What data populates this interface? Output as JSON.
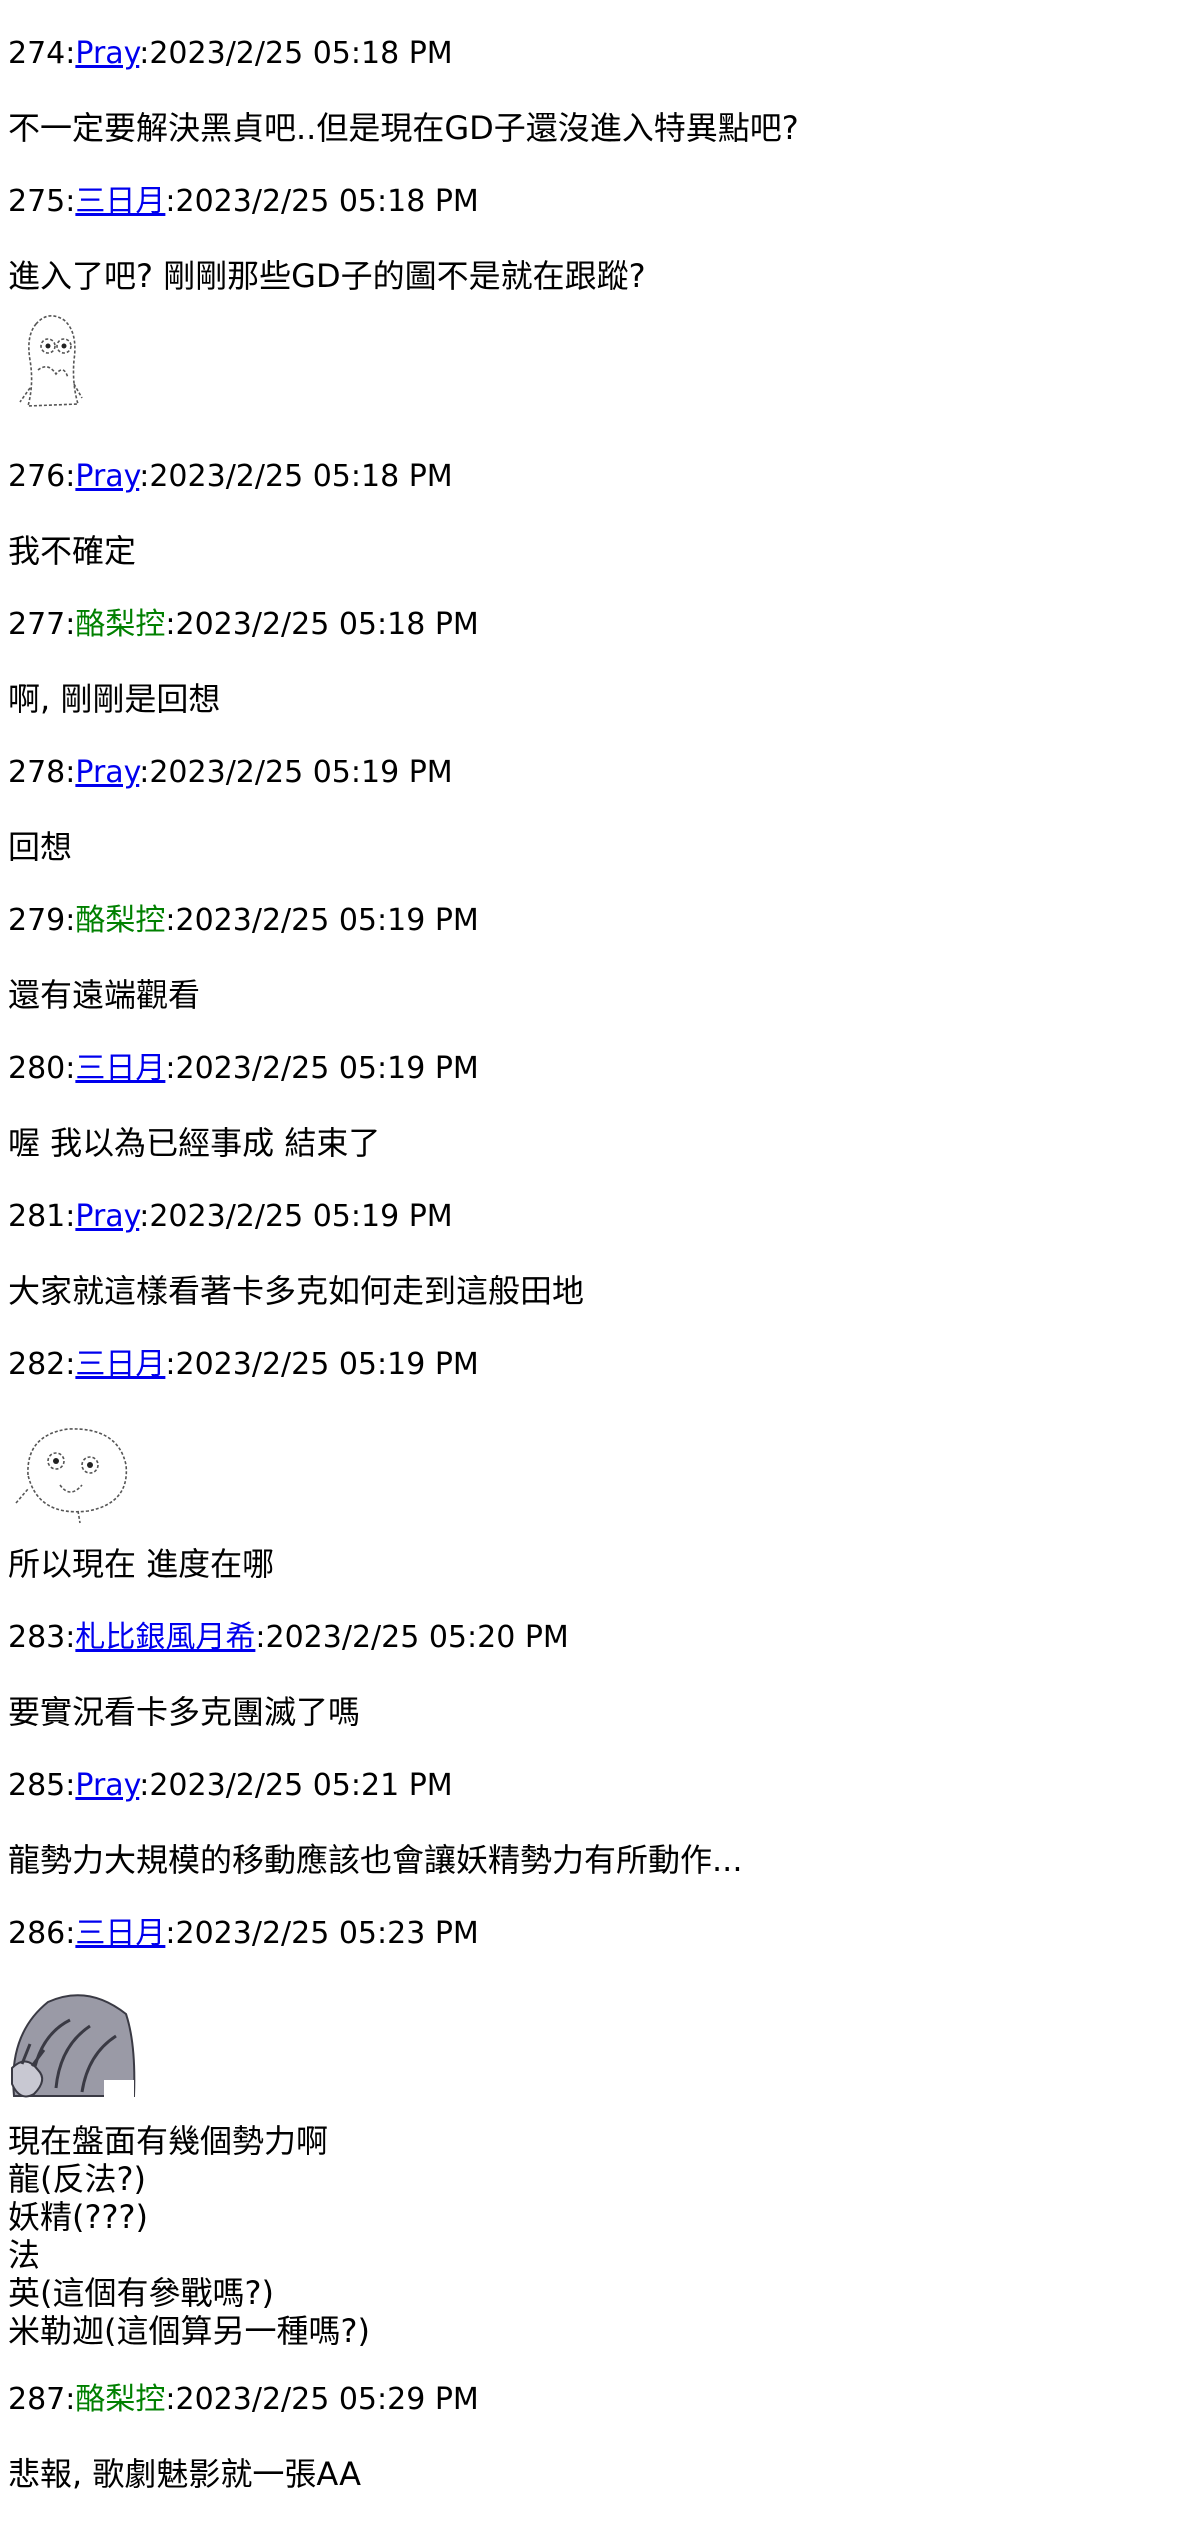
{
  "posts": [
    {
      "num": "274",
      "author": "Pray",
      "author_linked": true,
      "time": "2023/2/25 05:18 PM",
      "lines": [
        "不一定要解決黑貞吧..但是現在GD子還沒進入特異點吧?"
      ]
    },
    {
      "num": "275",
      "author": "三日月",
      "author_linked": true,
      "time": "2023/2/25 05:18 PM",
      "lines": [
        "進入了吧? 剛剛那些GD子的圖不是就在跟蹤?"
      ],
      "art": "sketch-ghost"
    },
    {
      "num": "276",
      "author": "Pray",
      "author_linked": true,
      "time": "2023/2/25 05:18 PM",
      "lines": [
        "我不確定"
      ]
    },
    {
      "num": "277",
      "author": "酪梨控",
      "author_linked": false,
      "time": "2023/2/25 05:18 PM",
      "lines": [
        "啊, 剛剛是回想"
      ]
    },
    {
      "num": "278",
      "author": "Pray",
      "author_linked": true,
      "time": "2023/2/25 05:19 PM",
      "lines": [
        "回想"
      ]
    },
    {
      "num": "279",
      "author": "酪梨控",
      "author_linked": false,
      "time": "2023/2/25 05:19 PM",
      "lines": [
        "還有遠端觀看"
      ]
    },
    {
      "num": "280",
      "author": "三日月",
      "author_linked": true,
      "time": "2023/2/25 05:19 PM",
      "lines": [
        "喔 我以為已經事成 結束了"
      ]
    },
    {
      "num": "281",
      "author": "Pray",
      "author_linked": true,
      "time": "2023/2/25 05:19 PM",
      "lines": [
        "大家就這樣看著卡多克如何走到這般田地"
      ]
    },
    {
      "num": "282",
      "author": "三日月",
      "author_linked": true,
      "time": "2023/2/25 05:19 PM",
      "art_before": "sketch-face",
      "lines": [
        "所以現在 進度在哪"
      ]
    },
    {
      "num": "283",
      "author": "札比銀風月希",
      "author_linked": true,
      "time": "2023/2/25 05:20 PM",
      "lines": [
        "要實況看卡多克團滅了嗎"
      ]
    },
    {
      "num": "285",
      "author": "Pray",
      "author_linked": true,
      "time": "2023/2/25 05:21 PM",
      "lines": [
        "龍勢力大規模的移動應該也會讓妖精勢力有所動作..."
      ]
    },
    {
      "num": "286",
      "author": "三日月",
      "author_linked": true,
      "time": "2023/2/25 05:23 PM",
      "art_before": "gray-character",
      "tight": true,
      "lines": [
        "現在盤面有幾個勢力啊",
        "龍(反法?)",
        "妖精(???)",
        "法",
        "英(這個有參戰嗎?)",
        "米勒迦(這個算另一種嗎?)"
      ]
    },
    {
      "num": "287",
      "author": "酪梨控",
      "author_linked": false,
      "time": "2023/2/25 05:29 PM",
      "lines": [
        "悲報, 歌劇魅影就一張AA"
      ]
    }
  ]
}
